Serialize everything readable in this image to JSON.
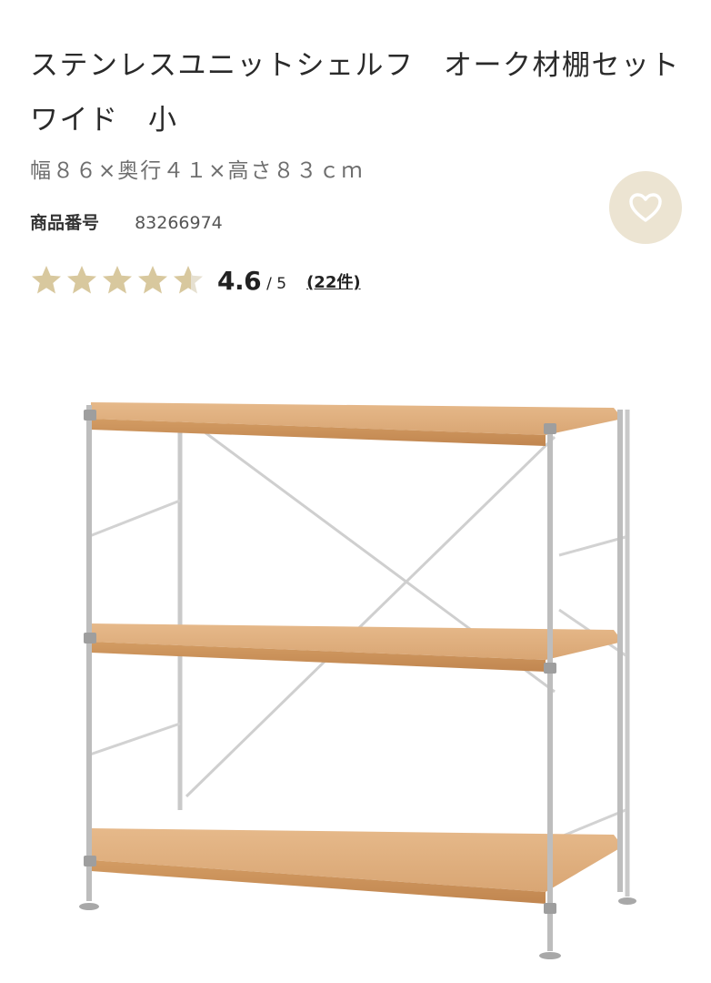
{
  "product": {
    "title": "ステンレスユニットシェルフ　オーク材棚セット　ワイド　小",
    "size": "幅８６×奥行４１×高さ８３ｃｍ",
    "code_label": "商品番号",
    "code_value": "83266974",
    "favorite_icon": "heart-icon"
  },
  "rating": {
    "score": "4.6",
    "out_of": "/ 5",
    "review_count": "(22件)",
    "stars_value": 4.6,
    "star_color": "#d8c89e",
    "star_empty_color": "#e6e0d0"
  },
  "image": {
    "description_icon": "shelf-product-image"
  }
}
